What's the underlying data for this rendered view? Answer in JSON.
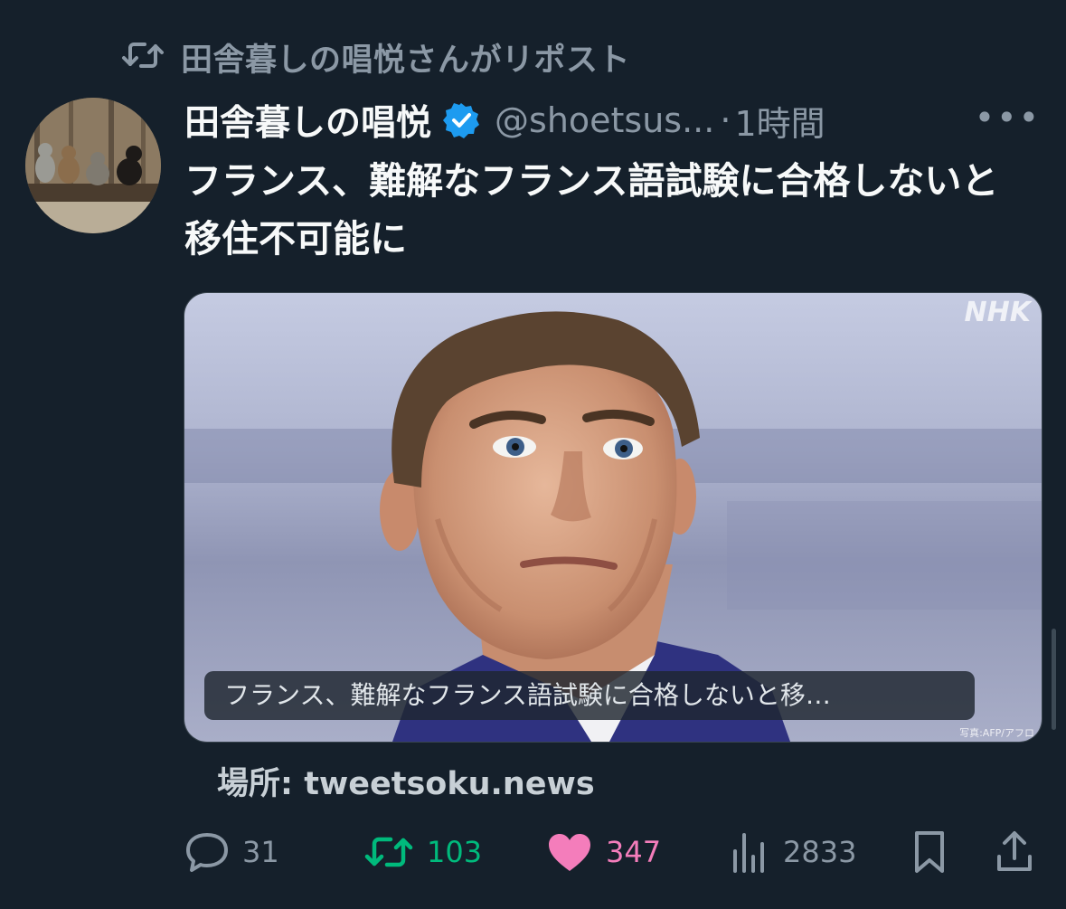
{
  "repost": {
    "label": "田舎暮しの唱悦さんがリポスト",
    "icon": "repost-icon"
  },
  "tweet": {
    "display_name": "田舎暮しの唱悦",
    "handle": "@shoetsus...",
    "separator": "·",
    "time": "1時間",
    "more_label": "•••",
    "text": "フランス、難解なフランス語試験に合格しないと移住不可能に"
  },
  "card": {
    "caption": "フランス、難解なフランス語試験に合格しないと移…",
    "watermark": "NHK",
    "photo_credit": "写真:AFP/アフロ"
  },
  "source": {
    "prefix": "場所:",
    "domain": "tweetsoku.news"
  },
  "actions": {
    "replies": "31",
    "reposts": "103",
    "likes": "347",
    "views": "2833"
  },
  "colors": {
    "background": "#15202b",
    "secondary_text": "#8b98a5",
    "verified": "#1d9bf0",
    "repost_active": "#00ba7c",
    "like_active": "#f91880"
  }
}
